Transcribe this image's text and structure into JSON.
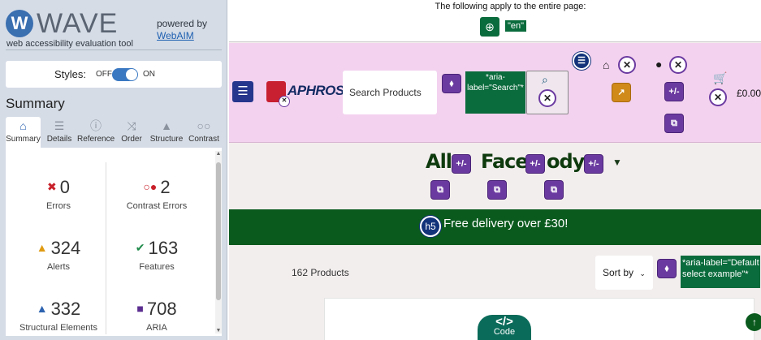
{
  "sidebar": {
    "logo": {
      "letter": "W",
      "word": "WAVE",
      "subtitle": "web accessibility evaluation tool"
    },
    "powered_by": "powered by",
    "webaim": "WebAIM",
    "styles": {
      "label": "Styles:",
      "off": "OFF",
      "on": "ON",
      "state": "on"
    },
    "summary_heading": "Summary",
    "tabs": [
      {
        "label": "Summary",
        "icon": "home-icon",
        "active": true
      },
      {
        "label": "Details",
        "icon": "list-icon",
        "active": false
      },
      {
        "label": "Reference",
        "icon": "info-icon",
        "active": false
      },
      {
        "label": "Order",
        "icon": "order-icon",
        "active": false
      },
      {
        "label": "Structure",
        "icon": "structure-icon",
        "active": false
      },
      {
        "label": "Contrast",
        "icon": "contrast-icon",
        "active": false
      }
    ],
    "stats": [
      {
        "value": "0",
        "label": "Errors",
        "icon": "error-icon",
        "color": "#c8202a"
      },
      {
        "value": "2",
        "label": "Contrast Errors",
        "icon": "contrast-error-icon",
        "color": "#c8202a"
      },
      {
        "value": "324",
        "label": "Alerts",
        "icon": "alert-icon",
        "color": "#e09b12"
      },
      {
        "value": "163",
        "label": "Features",
        "icon": "feature-icon",
        "color": "#1f8a4a"
      },
      {
        "value": "332",
        "label": "Structural Elements",
        "icon": "structure-icon",
        "color": "#2d63b0"
      },
      {
        "value": "708",
        "label": "ARIA",
        "icon": "aria-icon",
        "color": "#5b2d90"
      }
    ]
  },
  "page": {
    "top_notice": "The following apply to the entire page:",
    "lang_badge": "\"en\"",
    "brand": "APHROS",
    "search_placeholder": "Search Products",
    "search_aria": "*aria-label=\"Search\"*",
    "cart_total": "£0.00",
    "nav": {
      "all": "All",
      "face": "Face",
      "body": "ody"
    },
    "delivery": "Free delivery over £30!",
    "heading_badge": "h5",
    "product_count": "162 Products",
    "sort_label": "Sort by",
    "sort_aria": "*aria-label=\"Default select example\"*",
    "code_badge": "Code",
    "code_symbol": "</>"
  },
  "colors": {
    "header_bg": "#f3d2ef",
    "delivery_bg": "#0a5a1e",
    "aria_badge": "#6b3aa0",
    "wave_annotation": "#0a6b3c"
  }
}
